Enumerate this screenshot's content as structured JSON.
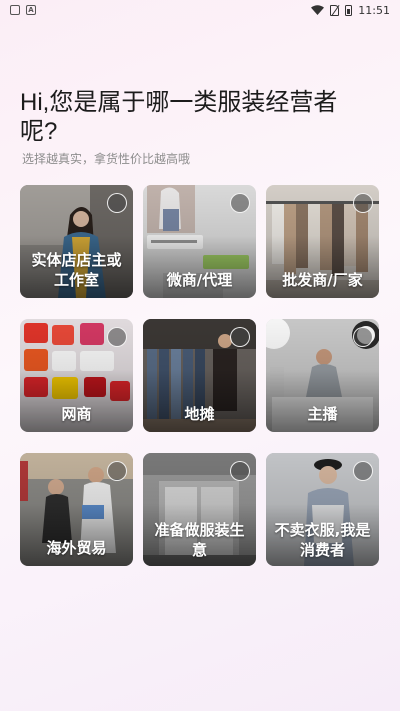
{
  "status_bar": {
    "left_icons": [
      "notification-icon",
      "a-icon"
    ],
    "time": "11:51"
  },
  "header": {
    "title": "Hi,您是属于哪一类服装经营者呢?",
    "subtitle": "选择越真实，拿货性价比越高哦"
  },
  "options": [
    {
      "label": "实体店店主或工作室",
      "image": "woman-in-blue-coat"
    },
    {
      "label": "微商/代理",
      "image": "chat-screenshot-with-clothes"
    },
    {
      "label": "批发商/厂家",
      "image": "clothing-rack"
    },
    {
      "label": "网商",
      "image": "ecommerce-app-logos"
    },
    {
      "label": "地摊",
      "image": "market-stall-jeans"
    },
    {
      "label": "主播",
      "image": "livestream-studio"
    },
    {
      "label": "海外贸易",
      "image": "shoppers-in-market"
    },
    {
      "label": "准备做服装生意",
      "image": "empty-storefront"
    },
    {
      "label": "不卖衣服,我是消费者",
      "image": "woman-in-cap"
    }
  ]
}
